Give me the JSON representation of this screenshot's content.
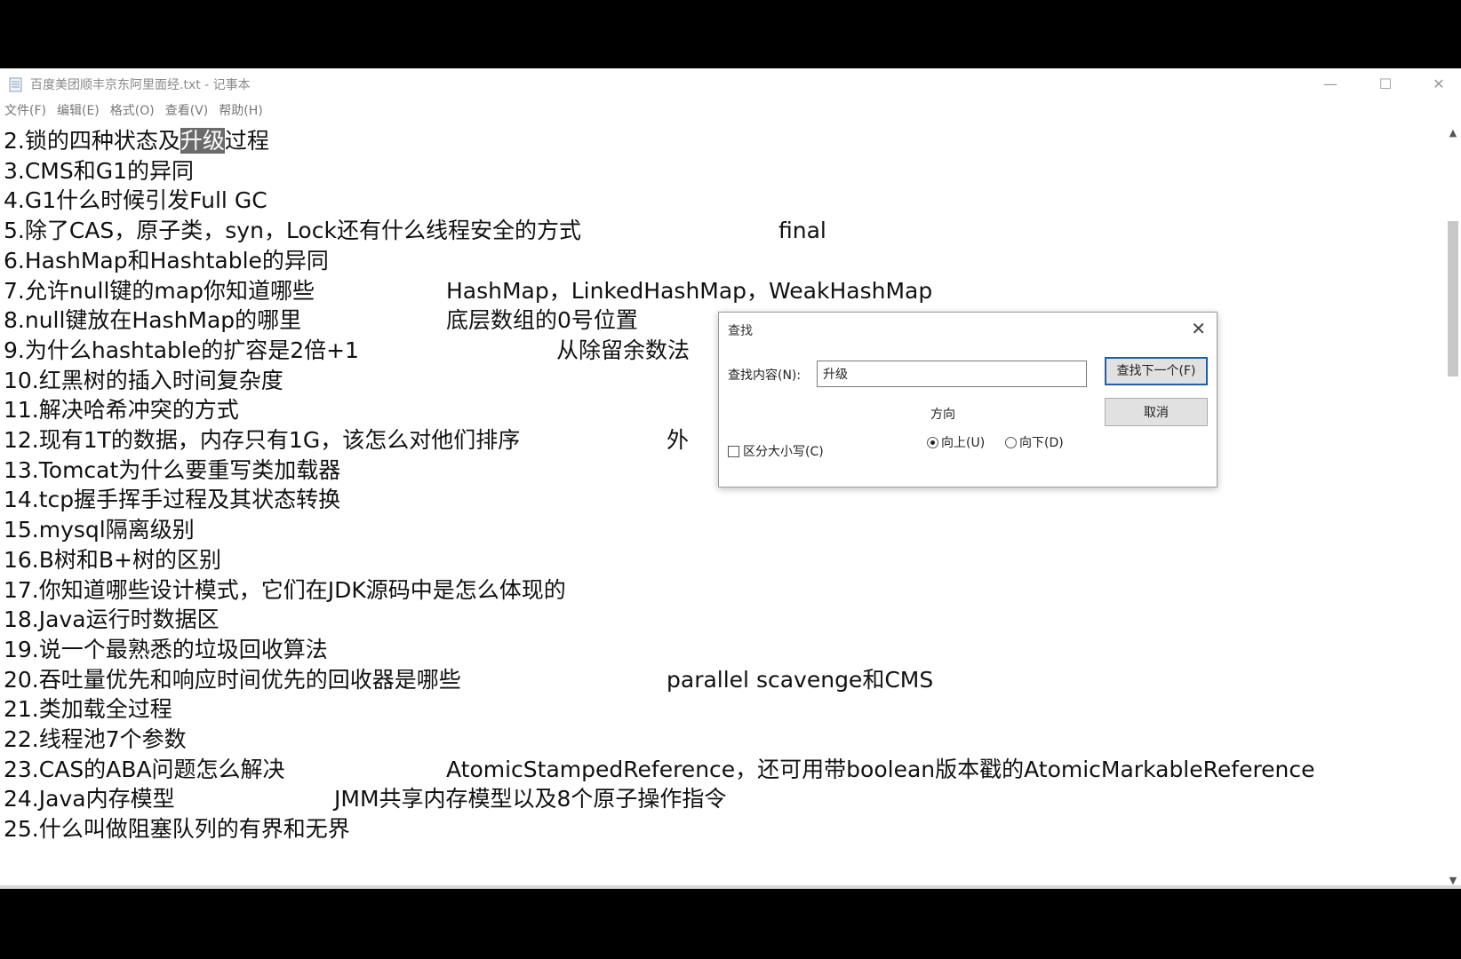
{
  "window": {
    "title": "百度美团顺丰京东阿里面经.txt - 记事本",
    "minimize": "—",
    "maximize": "☐",
    "close": "✕"
  },
  "menu": [
    "文件(F)",
    "编辑(E)",
    "格式(O)",
    "查看(V)",
    "帮助(H)"
  ],
  "lines": [
    {
      "pre": "2.锁的四种状态及",
      "hl": "升级",
      "post": "过程",
      "note": ""
    },
    {
      "pre": "3.CMS和G1的异同",
      "hl": "",
      "post": "",
      "note": ""
    },
    {
      "pre": "4.G1什么时候引发Full GC",
      "hl": "",
      "post": "",
      "note": ""
    },
    {
      "pre": "5.除了CAS，原子类，syn，Lock还有什么线程安全的方式",
      "hl": "",
      "post": "",
      "note": "final"
    },
    {
      "pre": "6.HashMap和Hashtable的异同",
      "hl": "",
      "post": "",
      "note": ""
    },
    {
      "pre": "7.允许null键的map你知道哪些",
      "hl": "",
      "post": "",
      "note": "HashMap，LinkedHashMap，WeakHashMap"
    },
    {
      "pre": "8.null键放在HashMap的哪里",
      "hl": "",
      "post": "",
      "note": "底层数组的0号位置"
    },
    {
      "pre": "9.为什么hashtable的扩容是2倍+1",
      "hl": "",
      "post": "",
      "note": "从除留余数法"
    },
    {
      "pre": "10.红黑树的插入时间复杂度",
      "hl": "",
      "post": "",
      "note": ""
    },
    {
      "pre": "11.解决哈希冲突的方式",
      "hl": "",
      "post": "",
      "note": ""
    },
    {
      "pre": "12.现有1T的数据，内存只有1G，该怎么对他们排序",
      "hl": "",
      "post": "",
      "note": "外"
    },
    {
      "pre": "13.Tomcat为什么要重写类加载器",
      "hl": "",
      "post": "",
      "note": ""
    },
    {
      "pre": "14.tcp握手挥手过程及其状态转换",
      "hl": "",
      "post": "",
      "note": ""
    },
    {
      "pre": "15.mysql隔离级别",
      "hl": "",
      "post": "",
      "note": ""
    },
    {
      "pre": "16.B树和B+树的区别",
      "hl": "",
      "post": "",
      "note": ""
    },
    {
      "pre": "17.你知道哪些设计模式，它们在JDK源码中是怎么体现的",
      "hl": "",
      "post": "",
      "note": ""
    },
    {
      "pre": "18.Java运行时数据区",
      "hl": "",
      "post": "",
      "note": ""
    },
    {
      "pre": "19.说一个最熟悉的垃圾回收算法",
      "hl": "",
      "post": "",
      "note": ""
    },
    {
      "pre": "20.吞吐量优先和响应时间优先的回收器是哪些",
      "hl": "",
      "post": "",
      "note": "parallel scavenge和CMS"
    },
    {
      "pre": "21.类加载全过程",
      "hl": "",
      "post": "",
      "note": ""
    },
    {
      "pre": "22.线程池7个参数",
      "hl": "",
      "post": "",
      "note": ""
    },
    {
      "pre": "23.CAS的ABA问题怎么解决",
      "hl": "",
      "post": "",
      "note": "AtomicStampedReference，还可用带boolean版本戳的AtomicMarkableReference"
    },
    {
      "pre": "24.Java内存模型",
      "hl": "",
      "post": "",
      "note": "JMM共享内存模型以及8个原子操作指令"
    },
    {
      "pre": "25.什么叫做阻塞队列的有界和无界",
      "hl": "",
      "post": "",
      "note": ""
    }
  ],
  "find_dialog": {
    "title": "查找",
    "close": "✕",
    "label": "查找内容(N):",
    "value": "升级",
    "find_next": "查找下一个(F)",
    "cancel": "取消",
    "direction_label": "方向",
    "up": "向上(U)",
    "down": "向下(D)",
    "direction_selected": "up",
    "match_case": "区分大小写(C)",
    "match_case_checked": false
  }
}
